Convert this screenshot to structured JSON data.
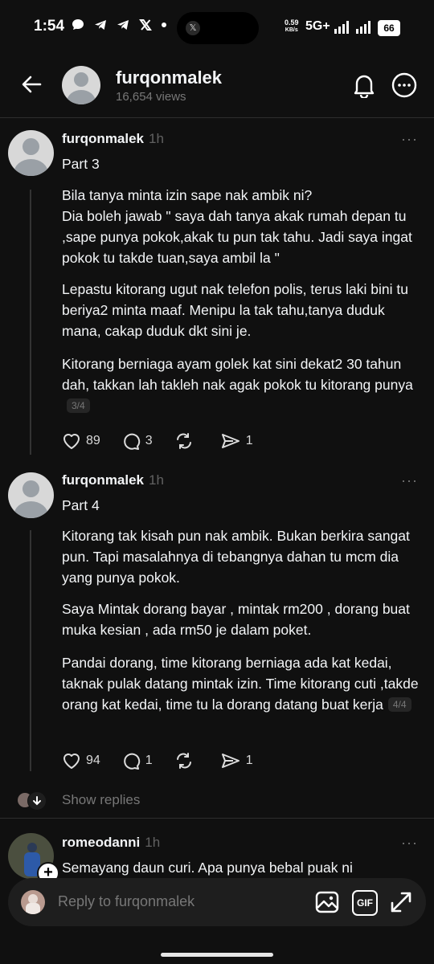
{
  "status": {
    "time": "1:54",
    "speed_value": "0.59",
    "speed_unit": "KB/s",
    "network": "5G+",
    "battery": "66",
    "notification_icons": [
      "chat-bubble-icon",
      "telegram-icon",
      "telegram-icon",
      "x-icon",
      "dot-icon"
    ]
  },
  "header": {
    "title": "furqonmalek",
    "views": "16,654 views"
  },
  "posts": [
    {
      "username": "furqonmalek",
      "time": "1h",
      "part": "Part 3",
      "paragraphs": [
        "Bila tanya minta izin sape nak ambik ni?\nDia boleh jawab \" saya dah tanya akak rumah depan tu ,sape punya pokok,akak tu pun tak tahu. Jadi saya ingat pokok tu takde tuan,saya ambil la \"",
        "Lepastu kitorang ugut nak telefon polis, terus laki bini tu beriya2 minta maaf.  Menipu la tak tahu,tanya duduk mana, cakap duduk dkt sini je.",
        "Kitorang berniaga ayam golek kat sini dekat2 30 tahun dah, takkan lah takleh nak agak  pokok tu kitorang punya"
      ],
      "page": "3/4",
      "likes": "89",
      "comments": "3",
      "shares": "1"
    },
    {
      "username": "furqonmalek",
      "time": "1h",
      "part": "Part 4",
      "paragraphs": [
        "Kitorang tak kisah pun nak ambik. Bukan berkira sangat pun. Tapi masalahnya di tebangnya dahan tu mcm dia yang punya pokok.",
        "Saya Mintak dorang bayar , mintak rm200 , dorang buat muka kesian , ada rm50 je dalam poket.",
        "Pandai dorang, time kitorang berniaga ada kat kedai, taknak pulak datang mintak izin. Time kitorang cuti ,takde orang kat kedai, time tu la dorang datang buat kerja"
      ],
      "page": "4/4",
      "likes": "94",
      "comments": "1",
      "shares": "1"
    }
  ],
  "show_replies": "Show replies",
  "reply": {
    "username": "romeodanni",
    "time": "1h",
    "text": "Semayang daun curi. Apa punya bebal puak ni"
  },
  "compose": {
    "placeholder": "Reply to furqonmalek",
    "gif_label": "GIF"
  },
  "colors": {
    "background": "#101010",
    "text": "#f3f5f7",
    "muted": "#777777"
  }
}
